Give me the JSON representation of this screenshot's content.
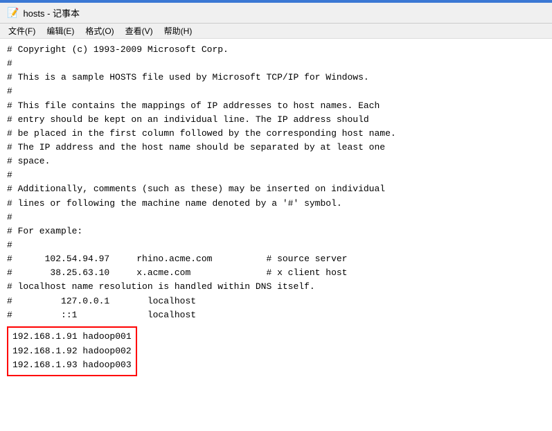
{
  "window": {
    "title": "hosts - 记事本",
    "top_bar_color": "#3b78d4"
  },
  "menu": {
    "items": [
      {
        "label": "文件(F)"
      },
      {
        "label": "编辑(E)"
      },
      {
        "label": "格式(O)"
      },
      {
        "label": "查看(V)"
      },
      {
        "label": "帮助(H)"
      }
    ]
  },
  "content": {
    "lines": [
      "# Copyright (c) 1993-2009 Microsoft Corp.",
      "#",
      "# This is a sample HOSTS file used by Microsoft TCP/IP for Windows.",
      "#",
      "# This file contains the mappings of IP addresses to host names. Each",
      "# entry should be kept on an individual line. The IP address should",
      "# be placed in the first column followed by the corresponding host name.",
      "# The IP address and the host name should be separated by at least one",
      "# space.",
      "#",
      "# Additionally, comments (such as these) may be inserted on individual",
      "# lines or following the machine name denoted by a '#' symbol.",
      "#",
      "# For example:",
      "#",
      "#      102.54.94.97     rhino.acme.com          # source server",
      "#       38.25.63.10     x.acme.com              # x client host",
      "",
      "# localhost name resolution is handled within DNS itself.",
      "#         127.0.0.1       localhost",
      "#         ::1             localhost"
    ],
    "highlighted_lines": [
      "192.168.1.91 hadoop001",
      "192.168.1.92 hadoop002",
      "192.168.1.93 hadoop003"
    ]
  }
}
